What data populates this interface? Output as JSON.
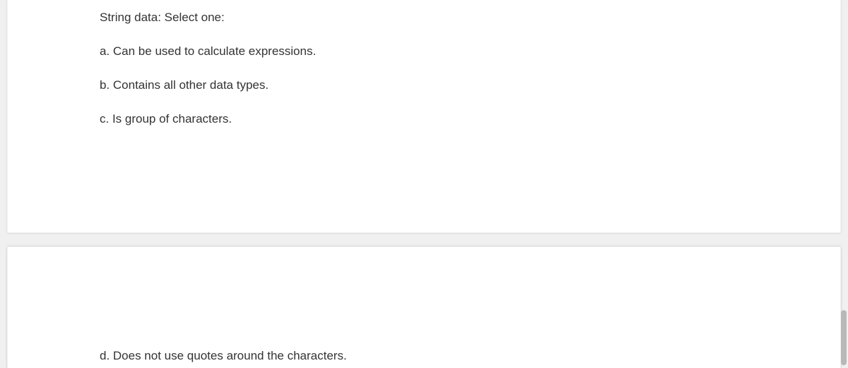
{
  "question": {
    "prompt": "String data: Select one:",
    "options": [
      "a. Can be used to calculate expressions.",
      "b. Contains all other data types.",
      "c. Is group of characters."
    ],
    "option_d": "d. Does not use quotes around the characters."
  }
}
